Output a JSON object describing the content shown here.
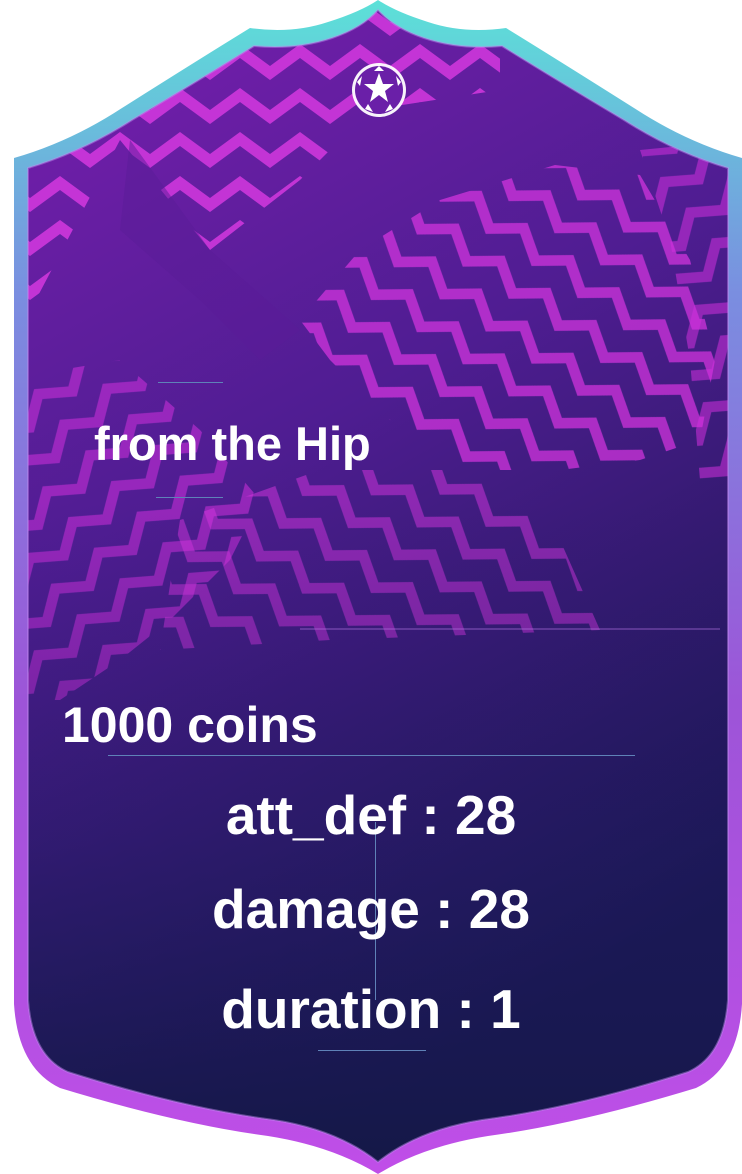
{
  "card": {
    "title": "from the Hip",
    "price": "1000 coins",
    "stats": [
      {
        "label": "att_def",
        "value": "28",
        "text": "att_def : 28"
      },
      {
        "label": "damage",
        "value": "28",
        "text": "damage : 28"
      },
      {
        "label": "duration",
        "value": "1",
        "text": "duration : 1"
      }
    ],
    "emblem_icon": "starball-icon",
    "colors": {
      "border_top": "#5ce1d8",
      "border_bottom": "#a646d8",
      "bg_top": "#6d1fa6",
      "bg_bottom": "#1a1a50",
      "stripe": "#e23ae6",
      "text": "#ffffff"
    }
  }
}
